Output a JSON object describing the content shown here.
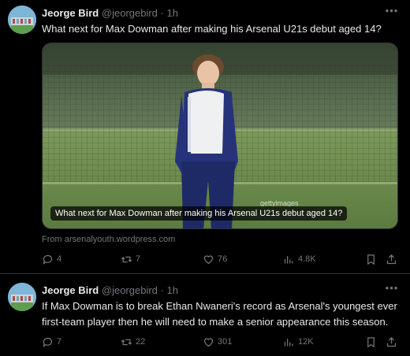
{
  "tweets": [
    {
      "author": {
        "name": "Jeorge Bird",
        "handle": "@jeorgebird",
        "separator": "·",
        "time": "1h"
      },
      "text": "What next for Max Dowman after making his Arsenal U21s debut aged 14?",
      "media": {
        "caption": "What next for Max Dowman after making his Arsenal U21s debut aged 14?",
        "watermark": "gettyimages"
      },
      "source": "From arsenalyouth.wordpress.com",
      "actions": {
        "replies": "4",
        "reposts": "7",
        "likes": "76",
        "views": "4.8K"
      }
    },
    {
      "author": {
        "name": "Jeorge Bird",
        "handle": "@jeorgebird",
        "separator": "·",
        "time": "1h"
      },
      "text": "If Max Dowman is to break Ethan Nwaneri's record as Arsenal's youngest ever first-team player then he will need to make a senior appearance this season.",
      "actions": {
        "replies": "7",
        "reposts": "22",
        "likes": "301",
        "views": "12K"
      }
    }
  ],
  "icons": {
    "more": "more-icon",
    "reply": "reply-icon",
    "repost": "repost-icon",
    "like": "heart-icon",
    "views": "views-icon",
    "bookmark": "bookmark-icon",
    "share": "share-icon"
  },
  "colors": {
    "background": "#000000",
    "text": "#e7e9ea",
    "muted": "#71767b",
    "divider": "#2f3336"
  }
}
